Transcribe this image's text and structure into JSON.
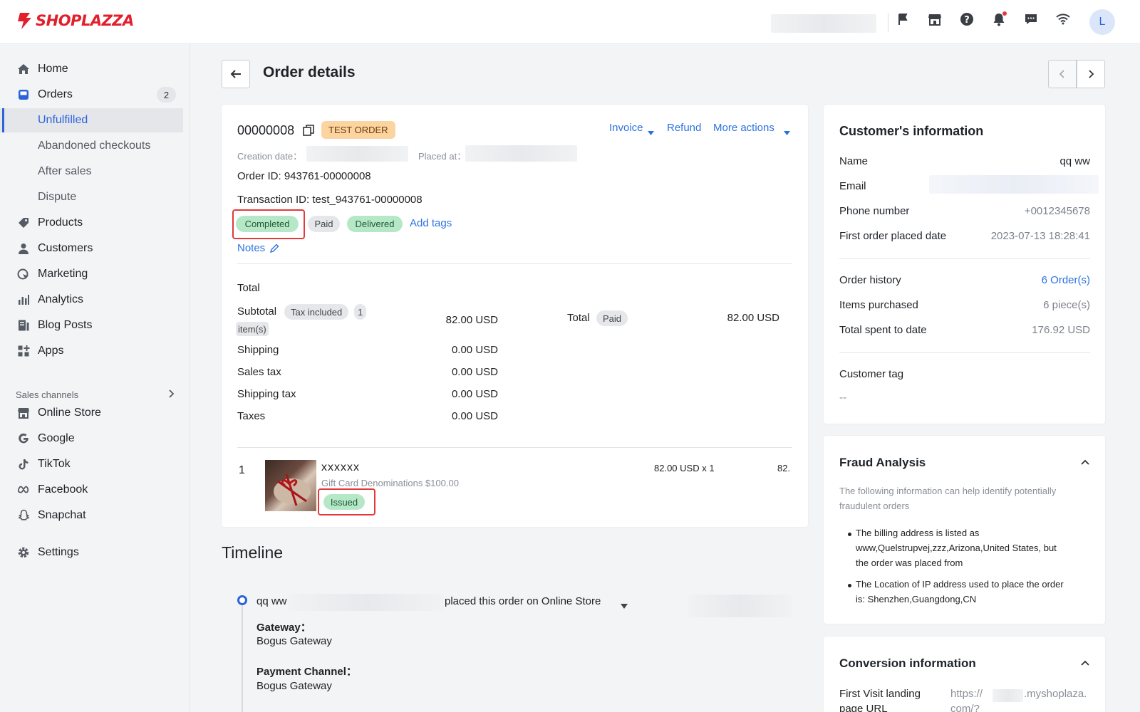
{
  "brand": {
    "name": "SHOPLAZZA",
    "color": "#e21f2b"
  },
  "accent": "#2c63d8",
  "topbar": {
    "icons": [
      "flag-icon",
      "store-icon",
      "help-icon",
      "bell-icon",
      "chat-icon",
      "wifi-icon"
    ],
    "avatar_initial": "L"
  },
  "sidebar": {
    "items": [
      {
        "label": "Home",
        "icon": "home-icon"
      },
      {
        "label": "Orders",
        "icon": "orders-icon",
        "count": "2"
      },
      {
        "label": "Unfulfilled",
        "sub": true,
        "active": true
      },
      {
        "label": "Abandoned checkouts",
        "sub": true
      },
      {
        "label": "After sales",
        "sub": true
      },
      {
        "label": "Dispute",
        "sub": true
      },
      {
        "label": "Products",
        "icon": "tag-icon"
      },
      {
        "label": "Customers",
        "icon": "person-icon"
      },
      {
        "label": "Marketing",
        "icon": "marketing-icon"
      },
      {
        "label": "Analytics",
        "icon": "analytics-icon"
      },
      {
        "label": "Blog Posts",
        "icon": "blog-icon"
      },
      {
        "label": "Apps",
        "icon": "apps-icon"
      }
    ],
    "sales_channels_label": "Sales channels",
    "channels": [
      {
        "label": "Online Store",
        "icon": "store-icon"
      },
      {
        "label": "Google",
        "icon": "google-icon"
      },
      {
        "label": "TikTok",
        "icon": "tiktok-icon"
      },
      {
        "label": "Facebook",
        "icon": "meta-icon"
      },
      {
        "label": "Snapchat",
        "icon": "snapchat-icon"
      }
    ],
    "settings_label": "Settings"
  },
  "page": {
    "title": "Order details"
  },
  "order": {
    "number": "00000008",
    "test_badge": "TEST ORDER",
    "actions": {
      "invoice": "Invoice",
      "refund": "Refund",
      "more": "More actions"
    },
    "creation_label": "Creation date：",
    "placed_label": "Placed at：",
    "order_id": "Order ID: 943761-00000008",
    "transaction_id": "Transaction ID: test_943761-00000008",
    "tags": {
      "completed": "Completed",
      "paid": "Paid",
      "delivered": "Delivered",
      "add": "Add tags"
    },
    "notes": "Notes",
    "total_heading": "Total",
    "subtotal_label": "Subtotal",
    "tax_included": "Tax included",
    "item_count_a": "1",
    "item_count_b": "item(s)",
    "subtotal_value": "82.00 USD",
    "rows": [
      {
        "label": "Shipping",
        "value": "0.00 USD"
      },
      {
        "label": "Sales tax",
        "value": "0.00 USD"
      },
      {
        "label": "Shipping tax",
        "value": "0.00 USD"
      },
      {
        "label": "Taxes",
        "value": "0.00 USD"
      }
    ],
    "total_label": "Total",
    "total_paid": "Paid",
    "total_value": "82.00 USD",
    "line_item": {
      "index": "1",
      "name": "xxxxxx",
      "variant": "Gift Card Denominations $100.00",
      "status": "Issued",
      "price_qty": "82.00 USD x 1",
      "amount": "82."
    }
  },
  "timeline": {
    "title": "Timeline",
    "event_prefix": "qq ww",
    "event_suffix": "placed this order on Online Store",
    "gateway_label": "Gateway：",
    "gateway_value": "Bogus Gateway",
    "channel_label": "Payment Channel：",
    "channel_value": "Bogus Gateway"
  },
  "customer": {
    "title": "Customer's information",
    "name_label": "Name",
    "name_value": "qq ww",
    "email_label": "Email",
    "phone_label": "Phone number",
    "phone_value": "+0012345678",
    "first_order_label": "First order placed date",
    "first_order_value": "2023-07-13 18:28:41",
    "history_label": "Order history",
    "history_value": "6 Order(s)",
    "items_label": "Items purchased",
    "items_value": "6 piece(s)",
    "spent_label": "Total spent to date",
    "spent_value": "176.92 USD",
    "tag_label": "Customer tag",
    "tag_value": "--"
  },
  "fraud": {
    "title": "Fraud Analysis",
    "intro_1": "The following information can help identify potentially",
    "intro_2": "fraudulent orders",
    "b1_1": "The billing address is listed as",
    "b1_2": "www,Quelstrupvej,zzz,Arizona,United States, but",
    "b1_3": "the order was placed from",
    "b2_1": "The Location of IP address used to place the order",
    "b2_2": "is: Shenzhen,Guangdong,CN"
  },
  "conversion": {
    "title": "Conversion information",
    "landing_label_1": "First Visit landing",
    "landing_label_2": "page URL",
    "landing_value_1": "https://",
    "landing_value_1b": ".myshoplaza.",
    "landing_value_2": "com/?"
  }
}
